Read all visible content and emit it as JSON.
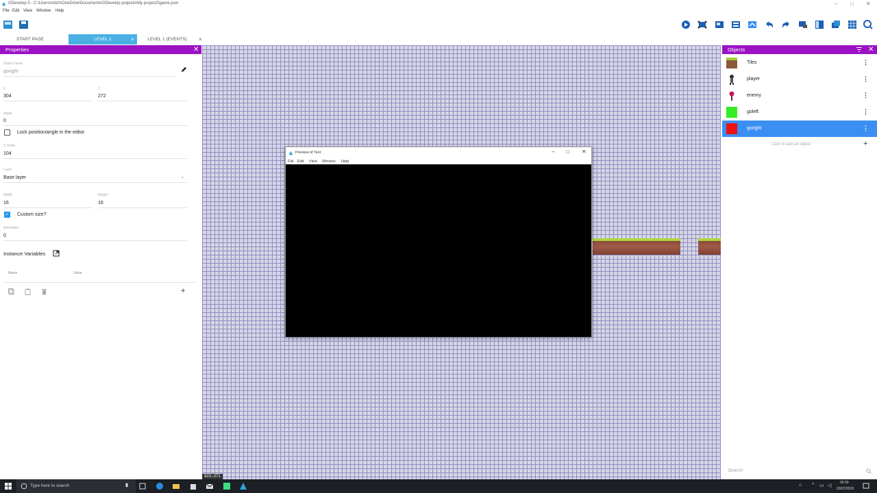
{
  "window": {
    "title": "GDevelop 5 - C:\\Users\\mitch\\OneDrive\\Documents\\GDevelop projects\\My project2\\game.json",
    "menu": [
      "File",
      "Edit",
      "View",
      "Window",
      "Help"
    ],
    "controls": {
      "minimize": "–",
      "maximize": "□",
      "close": "✕"
    }
  },
  "toolbar": {
    "left_icons": [
      "project-manager-icon",
      "save-icon"
    ],
    "right_icons": [
      "preview-play-icon",
      "network-preview-icon",
      "object-groups-icon",
      "instances-list-icon",
      "layers-icon",
      "undo-icon",
      "redo-icon",
      "grid-settings-icon",
      "layout-icon",
      "edit-objects-icon",
      "grid-toggle-icon",
      "zoom-icon"
    ]
  },
  "tabs": [
    {
      "label": "START PAGE",
      "active": false
    },
    {
      "label": "LEVEL 1",
      "active": true
    },
    {
      "label": "LEVEL 1 (EVENTS)",
      "active": false
    }
  ],
  "tab_close": "×",
  "properties": {
    "header": "Properties",
    "close": "✕",
    "object_name_label": "Object name",
    "object_name": "goright",
    "x_label": "X",
    "x": "304",
    "y_label": "Y",
    "y": "272",
    "angle_label": "Angle",
    "angle": "0",
    "lock_label": "Lock position/angle in the editor",
    "z_order_label": "Z Order",
    "z_order": "104",
    "layer_label": "Layer",
    "layer": "Base layer",
    "width_label": "Width",
    "width": "16",
    "height_label": "Height",
    "height": "16",
    "custom_size_label": "Custom size?",
    "animation_label": "Animation",
    "animation": "0",
    "instance_variables_label": "Instance Variables",
    "col_name": "Name",
    "col_value": "Value",
    "add": "+"
  },
  "preview": {
    "title": "Preview of Test",
    "menu": [
      "File",
      "Edit",
      "View",
      "Window",
      "Help"
    ],
    "controls": {
      "minimize": "–",
      "maximize": "□",
      "close": "✕"
    }
  },
  "scene": {
    "coords": "923;-371",
    "grid_color": "#8d8ec0",
    "background": "#d7d6e6"
  },
  "objects": {
    "header": "Objects",
    "items": [
      {
        "name": "Tiles",
        "thumb": "tiles-thumb",
        "color": "#8b5a3c"
      },
      {
        "name": "player",
        "thumb": "player-sprite-thumb",
        "color": "#333333"
      },
      {
        "name": "enemy",
        "thumb": "enemy-sprite-thumb",
        "color": "#c2185b"
      },
      {
        "name": "goleft",
        "thumb": "green-square-thumb",
        "color": "#33ee22"
      },
      {
        "name": "goright",
        "thumb": "red-square-thumb",
        "color": "#ee1111",
        "selected": true
      }
    ],
    "add_hint": "Click to add an object",
    "add": "+",
    "search_placeholder": "Search"
  },
  "taskbar": {
    "search_placeholder": "Type here to search",
    "time": "00:30",
    "date": "20/07/2019"
  },
  "colors": {
    "panel_header": "#9b12c4",
    "active_tab": "#4ab0e4",
    "selected_row": "#3b8ff3"
  }
}
